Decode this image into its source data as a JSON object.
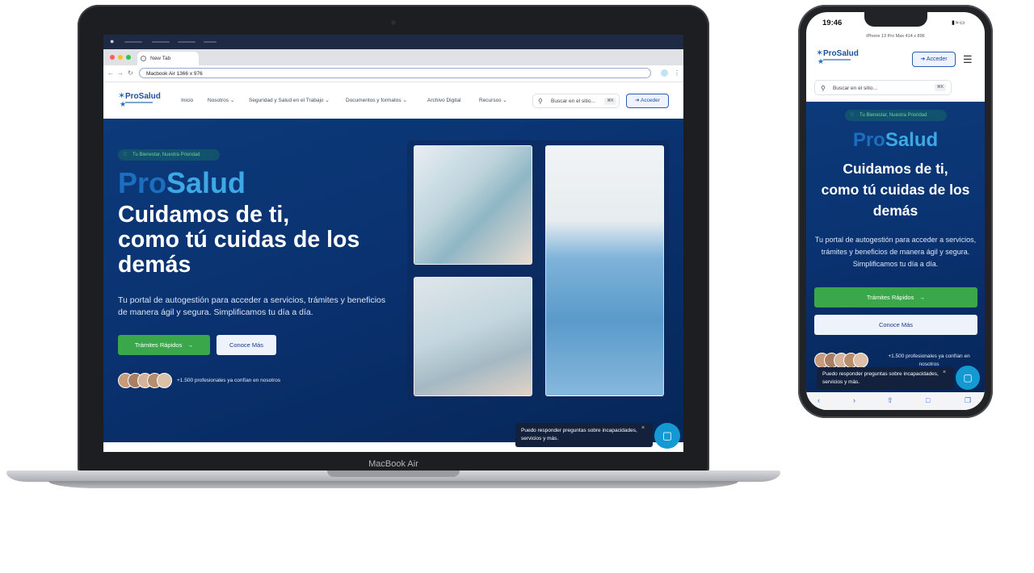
{
  "laptop": {
    "model_label": "MacBook Air",
    "browser": {
      "tab_title": "New Tab",
      "address_value": "Macbook Air  1366 x 976"
    }
  },
  "site": {
    "logo_text": "ProSalud",
    "nav": [
      "Inicio",
      "Nosotros ⌄",
      "Seguridad y Salud en el Trabajo ⌄",
      "Documentos y formatos ⌄",
      "Archivo Digital",
      "Recursos ⌄"
    ],
    "search_placeholder": "Buscar en el sitio...",
    "search_shortcut": "⌘K",
    "login_label": "Acceder",
    "hero": {
      "pill": "Tu Bienestar, Nuestra Prioridad",
      "brand_pro": "Pro",
      "brand_salud": "Salud",
      "title_line1": "Cuidamos de ti,",
      "title_line2": "como tú cuidas de los",
      "title_line3": "demás",
      "description": "Tu portal de autogestión para acceder a servicios, trámites y beneficios de manera ágil y segura. Simplificamos tu día a día.",
      "primary_cta": "Trámites Rápidos",
      "secondary_cta": "Conoce Más",
      "trust_text": "+1.500 profesionales ya confían en nosotros"
    },
    "chat": {
      "tooltip": "Puedo responder preguntas sobre incapacidades, servicios y más.",
      "close": "×"
    }
  },
  "phone": {
    "time": "19:46",
    "model_label": "iPhone 13 Pro Max  414 x 896",
    "search_placeholder": "Buscar en el sitio...",
    "trust_text": "+1.500 profesionales ya confían en nosotros"
  },
  "colors": {
    "hero_bg": "#0a3270",
    "brand_pro": "#1c6fc0",
    "brand_salud": "#3ea8e6",
    "cta_green": "#3aa84a",
    "chat_blue": "#1499d3"
  },
  "icons": [
    "apple-icon",
    "globe-icon",
    "back-icon",
    "forward-icon",
    "reload-icon",
    "search-icon",
    "login-icon",
    "heart-icon",
    "arrow-right-icon",
    "chat-icon",
    "close-icon",
    "menu-icon",
    "share-icon",
    "book-icon",
    "tabs-icon"
  ]
}
